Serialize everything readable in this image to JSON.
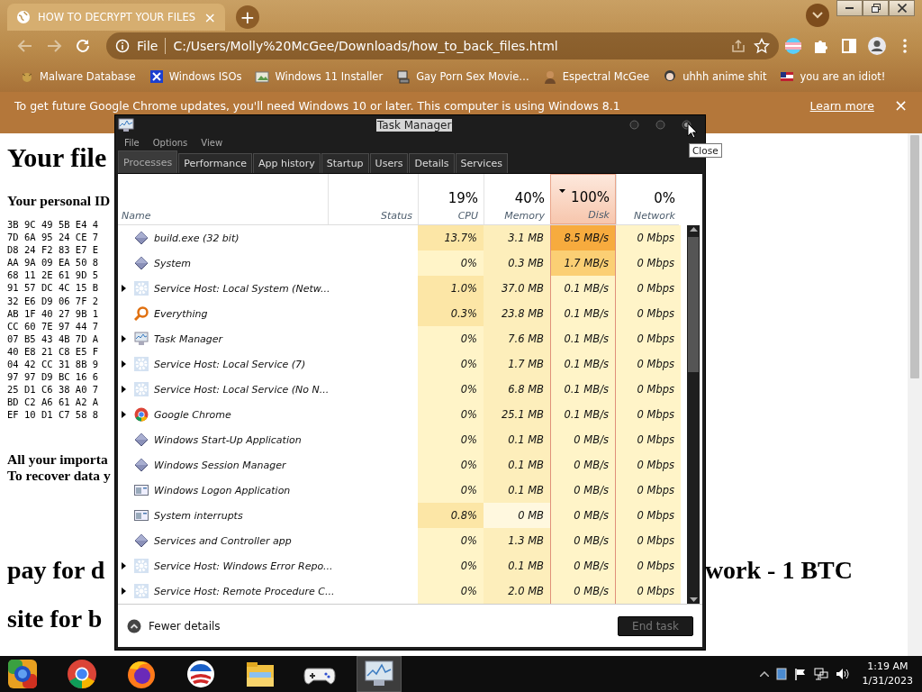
{
  "browser": {
    "tab": {
      "title": "HOW TO DECRYPT YOUR FILES",
      "close": "×"
    },
    "new_tab": "+",
    "address": {
      "scheme": "File",
      "url": "C:/Users/Molly%20McGee/Downloads/how_to_back_files.html"
    },
    "bookmarks": [
      {
        "label": "Malware Database",
        "kind": "bug"
      },
      {
        "label": "Windows ISOs",
        "kind": "xlogo"
      },
      {
        "label": "Windows 11 Installer",
        "kind": "installer"
      },
      {
        "label": "Gay Porn Sex Movie…",
        "kind": "computer"
      },
      {
        "label": "Espectral McGee",
        "kind": "avatar"
      },
      {
        "label": "uhhh anime shit",
        "kind": "avatar2"
      },
      {
        "label": "you are an idiot!",
        "kind": "flag"
      }
    ],
    "infobar": {
      "message": "To get future Google Chrome updates, you'll need Windows 10 or later. This computer is using Windows 8.1",
      "link": "Learn more",
      "close": "×"
    }
  },
  "page": {
    "heading": "Your file",
    "id_label": "Your personal ID",
    "id_lines": [
      "3B 9C 49 5B E4 4",
      "7D 6A 95 24 CE 7",
      "D8 24 F2 83 E7 E",
      "AA 9A 09 EA 50 8",
      "68 11 2E 61 9D 5",
      "91 57 DC 4C 15 B",
      "32 E6 D9 06 7F 2",
      "AB 1F 40 27 9B 1",
      "CC 60 7E 97 44 7",
      "07 B5 43 4B 7D A",
      "40 E8 21 C8 E5 F",
      "04 42 CC 31 8B 9",
      "97 97 D9 BC 16 6",
      "25 D1 C6 38 A0 7",
      "BD C2 A6 61 A2 A",
      "EF 10 D1 C7 58 8"
    ],
    "notice_lines": [
      "All your importa",
      "To recover data y"
    ],
    "big_line": {
      "left": "pay for d",
      "right": "work - 1 BTC"
    },
    "last_line": "site for b"
  },
  "task_manager": {
    "title": "Task Manager",
    "menu": [
      "File",
      "Options",
      "View"
    ],
    "tabs": [
      {
        "label": "Processes",
        "selected": true
      },
      {
        "label": "Performance",
        "selected": false
      },
      {
        "label": "App history",
        "selected": false
      },
      {
        "label": "Startup",
        "selected": false
      },
      {
        "label": "Users",
        "selected": false
      },
      {
        "label": "Details",
        "selected": false
      },
      {
        "label": "Services",
        "selected": false
      }
    ],
    "columns": [
      {
        "label": "Name",
        "sorted": false
      },
      {
        "label": "Status",
        "sorted": false
      },
      {
        "label": "CPU",
        "summary": "19%",
        "sorted": false
      },
      {
        "label": "Memory",
        "summary": "40%",
        "sorted": false
      },
      {
        "label": "Disk",
        "summary": "100%",
        "sorted": true
      },
      {
        "label": "Network",
        "summary": "0%",
        "sorted": false
      }
    ],
    "processes": [
      {
        "name": "build.exe (32 bit)",
        "kind": "diamond",
        "expandable": false,
        "cells": [
          {
            "text": "13.7%",
            "color": "#fce6a6"
          },
          {
            "text": "3.1 MB"
          },
          {
            "text": "8.5 MB/s",
            "color": "#f7ab3e"
          },
          {
            "text": "0 Mbps"
          }
        ]
      },
      {
        "name": "System",
        "kind": "diamond",
        "expandable": false,
        "cells": [
          {
            "text": "0%"
          },
          {
            "text": "0.3 MB"
          },
          {
            "text": "1.7 MB/s",
            "color": "#fbcf74"
          },
          {
            "text": "0 Mbps"
          }
        ]
      },
      {
        "name": "Service Host: Local System (Netw...",
        "kind": "gear",
        "expandable": true,
        "cells": [
          {
            "text": "1.0%",
            "color": "#fce6a6"
          },
          {
            "text": "37.0 MB"
          },
          {
            "text": "0.1 MB/s"
          },
          {
            "text": "0 Mbps"
          }
        ]
      },
      {
        "name": "Everything",
        "kind": "magnifier",
        "expandable": false,
        "cells": [
          {
            "text": "0.3%",
            "color": "#fce6a6"
          },
          {
            "text": "23.8 MB"
          },
          {
            "text": "0.1 MB/s"
          },
          {
            "text": "0 Mbps"
          }
        ]
      },
      {
        "name": "Task Manager",
        "kind": "monitor",
        "expandable": true,
        "cells": [
          {
            "text": "0%"
          },
          {
            "text": "7.6 MB"
          },
          {
            "text": "0.1 MB/s"
          },
          {
            "text": "0 Mbps"
          }
        ]
      },
      {
        "name": "Service Host: Local Service (7)",
        "kind": "gear",
        "expandable": true,
        "cells": [
          {
            "text": "0%"
          },
          {
            "text": "1.7 MB"
          },
          {
            "text": "0.1 MB/s"
          },
          {
            "text": "0 Mbps"
          }
        ]
      },
      {
        "name": "Service Host: Local Service (No N...",
        "kind": "gear",
        "expandable": true,
        "cells": [
          {
            "text": "0%"
          },
          {
            "text": "6.8 MB"
          },
          {
            "text": "0.1 MB/s"
          },
          {
            "text": "0 Mbps"
          }
        ]
      },
      {
        "name": "Google Chrome",
        "kind": "chrome",
        "expandable": true,
        "cells": [
          {
            "text": "0%"
          },
          {
            "text": "25.1 MB"
          },
          {
            "text": "0.1 MB/s"
          },
          {
            "text": "0 Mbps"
          }
        ]
      },
      {
        "name": "Windows Start-Up Application",
        "kind": "diamond",
        "expandable": false,
        "cells": [
          {
            "text": "0%"
          },
          {
            "text": "0.1 MB"
          },
          {
            "text": "0 MB/s"
          },
          {
            "text": "0 Mbps"
          }
        ]
      },
      {
        "name": "Windows Session Manager",
        "kind": "diamond",
        "expandable": false,
        "cells": [
          {
            "text": "0%"
          },
          {
            "text": "0.1 MB"
          },
          {
            "text": "0 MB/s"
          },
          {
            "text": "0 Mbps"
          }
        ]
      },
      {
        "name": "Windows Logon Application",
        "kind": "window",
        "expandable": false,
        "cells": [
          {
            "text": "0%"
          },
          {
            "text": "0.1 MB"
          },
          {
            "text": "0 MB/s"
          },
          {
            "text": "0 Mbps"
          }
        ]
      },
      {
        "name": "System interrupts",
        "kind": "window",
        "expandable": false,
        "cells": [
          {
            "text": "0.8%",
            "color": "#fce6a6"
          },
          {
            "text": "0 MB",
            "color": "#fff8df"
          },
          {
            "text": "0 MB/s"
          },
          {
            "text": "0 Mbps"
          }
        ]
      },
      {
        "name": "Services and Controller app",
        "kind": "diamond",
        "expandable": false,
        "cells": [
          {
            "text": "0%"
          },
          {
            "text": "1.3 MB"
          },
          {
            "text": "0 MB/s"
          },
          {
            "text": "0 Mbps"
          }
        ]
      },
      {
        "name": "Service Host: Windows Error Repo...",
        "kind": "gear",
        "expandable": true,
        "cells": [
          {
            "text": "0%"
          },
          {
            "text": "0.1 MB"
          },
          {
            "text": "0 MB/s"
          },
          {
            "text": "0 Mbps"
          }
        ]
      },
      {
        "name": "Service Host: Remote Procedure C...",
        "kind": "gear",
        "expandable": true,
        "cells": [
          {
            "text": "0%"
          },
          {
            "text": "2.0 MB"
          },
          {
            "text": "0 MB/s"
          },
          {
            "text": "0 Mbps"
          }
        ]
      }
    ],
    "footer": {
      "toggle": "Fewer details",
      "end_task": {
        "label": "End task",
        "disabled": true
      }
    },
    "tooltip": "Close"
  },
  "taskbar": {
    "apps": [
      {
        "kind": "orb",
        "active": false
      },
      {
        "kind": "chrome",
        "active": false
      },
      {
        "kind": "firefox",
        "active": false
      },
      {
        "kind": "campaign",
        "active": false
      },
      {
        "kind": "folder",
        "active": false
      },
      {
        "kind": "gamepad",
        "active": false
      },
      {
        "kind": "monitor",
        "active": true
      }
    ],
    "clock": {
      "time": "1:19 AM",
      "date": "1/31/2023"
    }
  }
}
